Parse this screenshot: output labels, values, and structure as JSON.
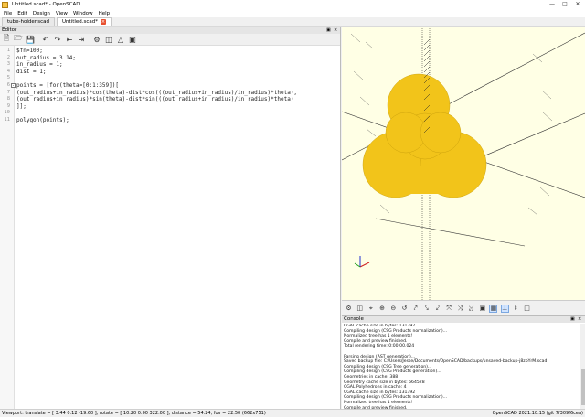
{
  "window": {
    "title": "Untitled.scad* - OpenSCAD"
  },
  "menu": [
    "File",
    "Edit",
    "Design",
    "View",
    "Window",
    "Help"
  ],
  "tabs": [
    {
      "label": "tube-holder.scad"
    },
    {
      "label": "Untitled.scad*"
    }
  ],
  "editor": {
    "header": "Editor",
    "lines": [
      {
        "n": "1",
        "text": "$fn=100;"
      },
      {
        "n": "2",
        "text": "out_radius = 3.14;"
      },
      {
        "n": "3",
        "text": "in_radius = 1;"
      },
      {
        "n": "4",
        "text": "dist = 1;"
      },
      {
        "n": "5",
        "text": ""
      },
      {
        "n": "6",
        "text": "points = [for(theta=[0:1:359])["
      },
      {
        "n": "7",
        "text": "(out_radius+in_radius)*cos(theta)-dist*cos(((out_radius+in_radius)/in_radius)*theta),"
      },
      {
        "n": "8",
        "text": "(out_radius+in_radius)*sin(theta)-dist*sin(((out_radius+in_radius)/in_radius)*theta)"
      },
      {
        "n": "9",
        "text": "]];"
      },
      {
        "n": "10",
        "text": ""
      },
      {
        "n": "11",
        "text": "polygon(points);"
      }
    ]
  },
  "viewport": {
    "shape_color": "#f2c41a",
    "background": "#ffffe5"
  },
  "console": {
    "header": "Console",
    "lines": [
      "CGAL cache size in bytes: 131392",
      "Compiling design (CSG Products normalization)...",
      "Normalized tree has 1 elements!",
      "Compile and preview finished.",
      "Total rendering time: 0:00:00.024",
      "",
      "Parsing design (AST generation)...",
      "Saved backup file: C:/Users/Jesse/Documents/OpenSCAD/backups/unsaved-backup-j8zbYrM.scad",
      "Compiling design (CSG Tree generation)...",
      "Compiling design (CSG Products generation)...",
      "Geometries in cache: 388",
      "Geometry cache size in bytes: 664528",
      "CGAL Polyhedrons in cache: 4",
      "CGAL cache size in bytes: 131392",
      "Compiling design (CSG Products normalization)...",
      "Normalized tree has 1 elements!",
      "Compile and preview finished.",
      "Total rendering time: 0:00:00.015"
    ]
  },
  "status": {
    "viewport_info": "Viewport: translate = [ 3.44 0.12 -19.60 ], rotate = [ 10.20 0.00 322.00 ], distance = 54.24, fov = 22.50 (662x751)",
    "version": "OpenSCAD 2021.10.15 (git 7f309f6cea)"
  }
}
